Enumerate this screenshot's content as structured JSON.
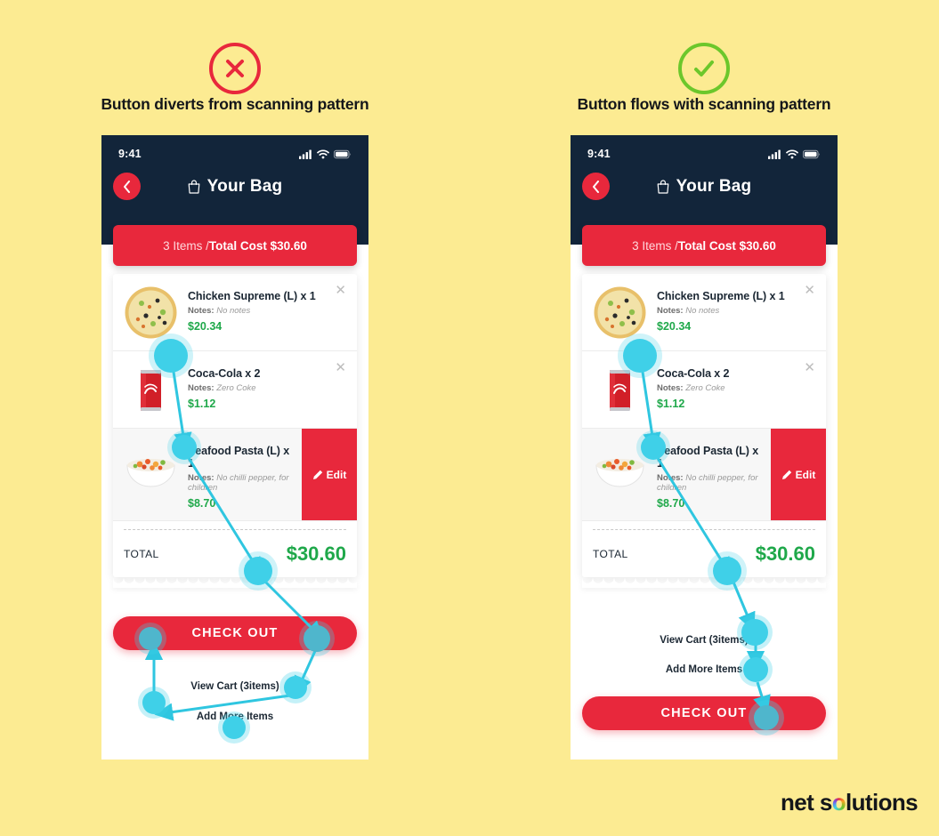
{
  "background_color": "#FCEB92",
  "accent_red": "#E8283C",
  "accent_green": "#1FA84A",
  "accent_cyan": "#3FD0E8",
  "dark_navy": "#12253A",
  "panels": [
    {
      "id": "bad",
      "verdict": "bad",
      "verdict_icon": "cross-circle-icon",
      "verdict_color": "#E8283C",
      "caption": "Button diverts from scanning pattern"
    },
    {
      "id": "good",
      "verdict": "good",
      "verdict_icon": "check-circle-icon",
      "verdict_color": "#6CC72B",
      "caption": "Button flows with scanning pattern"
    }
  ],
  "phone": {
    "status": {
      "time": "9:41",
      "signal_icon": "cellular-bars-icon",
      "wifi_icon": "wifi-icon",
      "battery_icon": "battery-icon"
    },
    "nav": {
      "back_icon": "chevron-left-icon",
      "bag_icon": "shopping-bag-icon",
      "title": "Your Bag"
    },
    "summary": {
      "count_text": "3 Items / ",
      "total_text": "Total Cost $30.60"
    },
    "items": [
      {
        "thumb_icon": "pizza-icon",
        "title": "Chicken Supreme (L) x 1",
        "notes_label": "Notes:",
        "notes_value": " No notes",
        "price": "$20.34",
        "remove_icon": "close-icon",
        "has_edit": false
      },
      {
        "thumb_icon": "cola-can-icon",
        "title": "Coca-Cola x 2",
        "notes_label": "Notes:",
        "notes_value": " Zero Coke",
        "price": "$1.12",
        "remove_icon": "close-icon",
        "has_edit": false
      },
      {
        "thumb_icon": "pasta-bowl-icon",
        "title": "Seafood Pasta (L) x 1",
        "notes_label": "Notes:",
        "notes_value": " No chilli pepper, for children",
        "price": "$8.70",
        "remove_icon": "close-icon",
        "has_edit": true,
        "edit_label": "Edit",
        "edit_icon": "pencil-icon"
      }
    ],
    "total": {
      "label": "TOTAL",
      "value": "$30.60"
    },
    "actions": {
      "checkout_label": "CHECK OUT",
      "view_cart_label": "View Cart (3items)",
      "add_more_label": "Add More Items"
    }
  },
  "brand": {
    "part1": "net s",
    "part_o": "o",
    "part2": "lutions"
  }
}
